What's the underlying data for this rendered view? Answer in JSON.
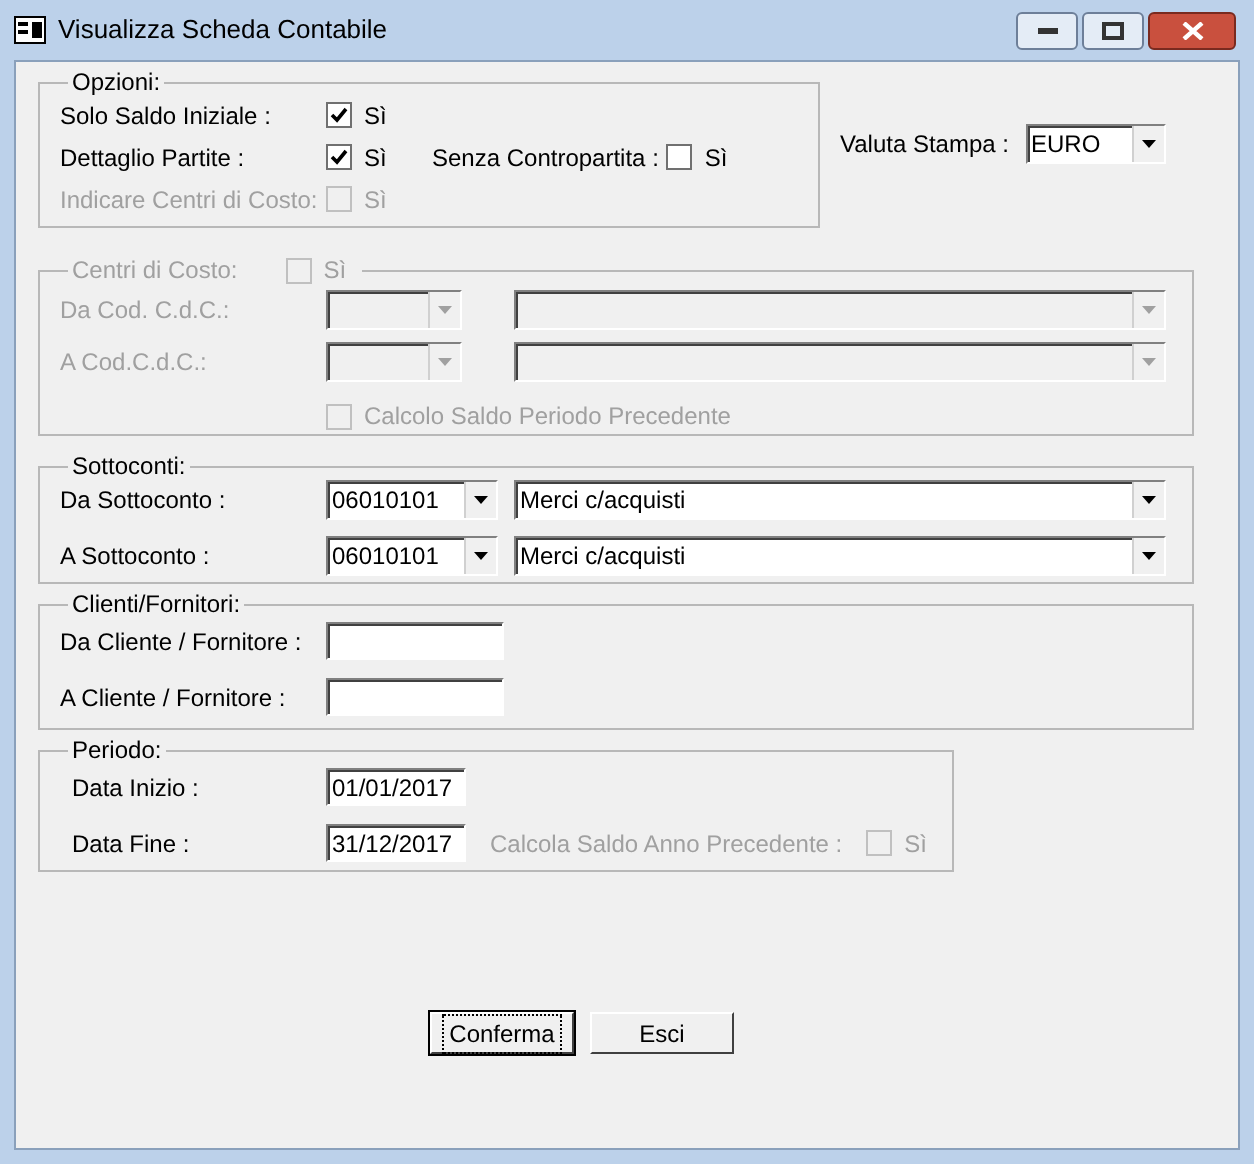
{
  "window": {
    "title": "Visualizza Scheda Contabile"
  },
  "options": {
    "legend": "Opzioni:",
    "rows": [
      {
        "label": "Solo Saldo Iniziale :",
        "disabled": false,
        "checkbox": {
          "label": "Sì",
          "checked": true,
          "disabled": false
        }
      },
      {
        "label": "Dettaglio Partite :",
        "disabled": false,
        "checkbox": {
          "label": "Sì",
          "checked": true,
          "disabled": false
        },
        "extra": {
          "label": "Senza Contropartita :",
          "checkbox": {
            "label": "Sì",
            "checked": false,
            "disabled": false
          }
        }
      },
      {
        "label": "Indicare Centri di Costo:",
        "disabled": true,
        "checkbox": {
          "label": "Sì",
          "checked": false,
          "disabled": true
        }
      }
    ]
  },
  "valuta": {
    "label": "Valuta Stampa :",
    "value": "EURO"
  },
  "cost_centers": {
    "legend": "Centri di Costo:",
    "disabled": true,
    "checkbox": {
      "label": "Sì",
      "checked": false,
      "disabled": true
    },
    "rows": [
      {
        "label": "Da Cod. C.d.C.:"
      },
      {
        "label": "A Cod.C.d.C.:"
      }
    ],
    "calc": {
      "label": "Calcolo Saldo Periodo Precedente",
      "checked": false,
      "disabled": true
    }
  },
  "sottoconti": {
    "legend": "Sottoconti:",
    "rows": [
      {
        "label": "Da Sottoconto :",
        "code": "06010101",
        "description": "Merci c/acquisti"
      },
      {
        "label": "A Sottoconto :",
        "code": "06010101",
        "description": "Merci c/acquisti"
      }
    ]
  },
  "clients": {
    "legend": "Clienti/Fornitori:",
    "rows": [
      {
        "label": "Da Cliente / Fornitore :"
      },
      {
        "label": "A Cliente / Fornitore :"
      }
    ]
  },
  "period": {
    "legend": "Periodo:",
    "rows": [
      {
        "label": "Data Inizio :",
        "value": "01/01/2017"
      },
      {
        "label": "Data Fine :",
        "value": "31/12/2017"
      }
    ],
    "prev_year": {
      "label": "Calcola Saldo Anno Precedente :",
      "checkbox": {
        "label": "Sì",
        "checked": false,
        "disabled": true
      }
    }
  },
  "buttons": [
    {
      "label": "Conferma",
      "focused": true
    },
    {
      "label": "Esci",
      "focused": false
    }
  ]
}
